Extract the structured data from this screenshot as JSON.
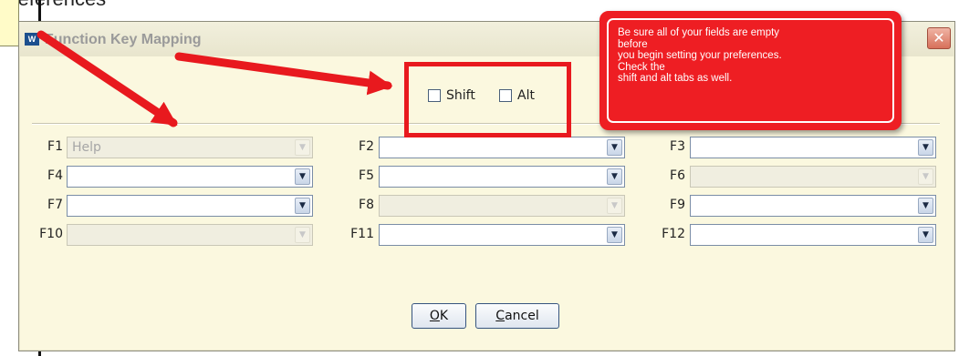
{
  "background": {
    "cropped_text": "preferences",
    "accent_red": "#e8191e"
  },
  "window": {
    "title": "Function Key Mapping",
    "app_icon": "app-logo-icon",
    "close_glyph": "✕"
  },
  "modifiers": {
    "shift_label": "Shift",
    "alt_label": "Alt",
    "shift_checked": false,
    "alt_checked": false
  },
  "function_keys": [
    {
      "key": "F1",
      "value": "Help",
      "enabled": false
    },
    {
      "key": "F2",
      "value": "",
      "enabled": true
    },
    {
      "key": "F3",
      "value": "",
      "enabled": true
    },
    {
      "key": "F4",
      "value": "",
      "enabled": true
    },
    {
      "key": "F5",
      "value": "",
      "enabled": true
    },
    {
      "key": "F6",
      "value": "",
      "enabled": false
    },
    {
      "key": "F7",
      "value": "",
      "enabled": true
    },
    {
      "key": "F8",
      "value": "",
      "enabled": false
    },
    {
      "key": "F9",
      "value": "",
      "enabled": true
    },
    {
      "key": "F10",
      "value": "",
      "enabled": false
    },
    {
      "key": "F11",
      "value": "",
      "enabled": true
    },
    {
      "key": "F12",
      "value": "",
      "enabled": true
    }
  ],
  "buttons": {
    "ok_mnemonic": "O",
    "ok_rest": "K",
    "cancel_mnemonic": "C",
    "cancel_rest": "ancel"
  },
  "annotation": {
    "text": "Be sure all of your fields are empty\nbefore\nyou begin setting your preferences.\nCheck the\nshift and alt tabs as well."
  }
}
